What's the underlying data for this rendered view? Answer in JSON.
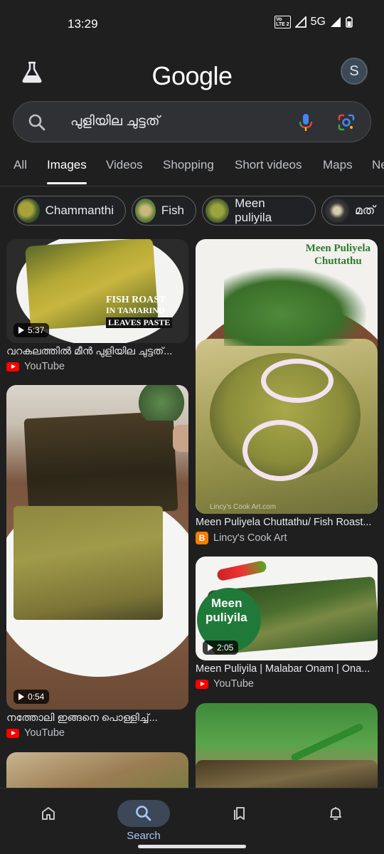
{
  "status_bar": {
    "time": "13:29",
    "volte_label": "Vo LTE 2",
    "network": "5G"
  },
  "header": {
    "logo": "Google",
    "avatar_initial": "S"
  },
  "search": {
    "query": "പുളിയില ചുട്ടത്"
  },
  "tabs": [
    {
      "label": "All"
    },
    {
      "label": "Images",
      "active": true
    },
    {
      "label": "Videos"
    },
    {
      "label": "Shopping"
    },
    {
      "label": "Short videos"
    },
    {
      "label": "Maps"
    },
    {
      "label": "Ne"
    }
  ],
  "chips": [
    {
      "label": "Chammanthi"
    },
    {
      "label": "Fish"
    },
    {
      "label": "Meen puliyila"
    },
    {
      "label": "മത്"
    }
  ],
  "results": {
    "r1": {
      "title": "വറകലത്തിൽ മീൻ പുളിയില ചുട്ടത്...",
      "source": "YouTube",
      "duration": "5:37",
      "overlay1": "FISH ROAST",
      "overlay2": "IN TAMARIND",
      "overlay3": "LEAVES PASTE"
    },
    "r2": {
      "title": "നത്തോലി ഇങ്ങനെ പൊള്ളിച്ച്...",
      "source": "YouTube",
      "duration": "0:54"
    },
    "r3": {
      "title": "Meen Puliyela Chuttathu/ Fish Roast...",
      "source": "Lincy's Cook Art",
      "overlay1": "Meen Puliyela",
      "overlay2": "Chuttathu",
      "watermark": "Lincy's Cook Art.com"
    },
    "r4": {
      "title": "Meen Puliyila | Malabar Onam | Ona...",
      "source": "YouTube",
      "duration": "2:05",
      "overlay1": "Meen",
      "overlay2": "puliyila"
    }
  },
  "bottom_nav": {
    "search_label": "Search"
  },
  "colors": {
    "background": "#1f1f1f",
    "accent": "#a8c7fa",
    "youtube": "#ff0000",
    "blogger": "#f57d00"
  }
}
